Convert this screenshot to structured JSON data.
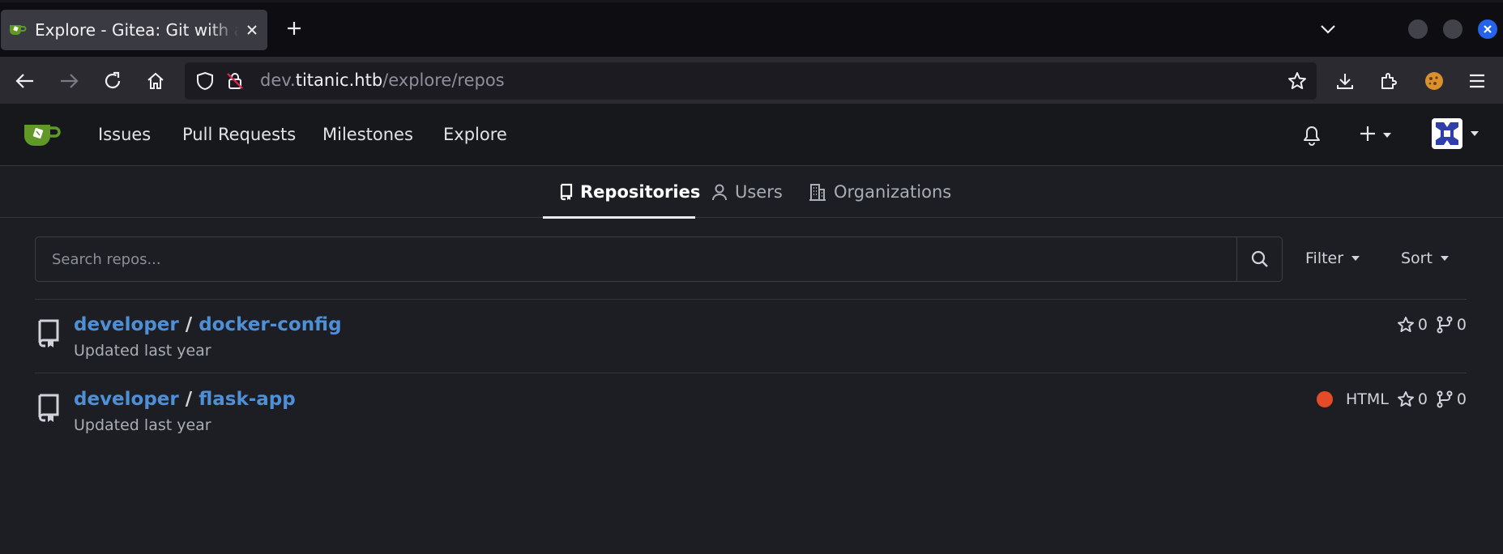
{
  "browser": {
    "tab_title": "Explore - Gitea: Git with a cup of tea",
    "url_host": "dev.titanic.htb",
    "url_prefix": "dev.",
    "url_domain": "titanic.htb",
    "url_path": "/explore/repos"
  },
  "nav": {
    "items": [
      "Issues",
      "Pull Requests",
      "Milestones",
      "Explore"
    ]
  },
  "explore_tabs": {
    "repositories": "Repositories",
    "users": "Users",
    "organizations": "Organizations"
  },
  "search": {
    "placeholder": "Search repos...",
    "filter_label": "Filter",
    "sort_label": "Sort"
  },
  "repos": [
    {
      "owner": "developer",
      "separator": "/",
      "name": "docker-config",
      "updated": "Updated last year",
      "language": "",
      "stars": "0",
      "forks": "0"
    },
    {
      "owner": "developer",
      "separator": "/",
      "name": "flask-app",
      "updated": "Updated last year",
      "language": "HTML",
      "language_color": "#e34c26",
      "stars": "0",
      "forks": "0"
    }
  ],
  "colors": {
    "link": "#4f8fd6",
    "accent_logo": "#609926"
  },
  "icons": {
    "tab_favicon": "gitea-icon",
    "tab_close": "close-icon",
    "new_tab": "plus-icon",
    "tab_list": "chevron-down-icon",
    "back": "arrow-left-icon",
    "forward": "arrow-right-icon",
    "reload": "reload-icon",
    "home": "home-icon",
    "shield": "shield-icon",
    "insecure": "lock-insecure-icon",
    "bookmark": "star-icon",
    "downloads": "download-icon",
    "extensions": "puzzle-icon",
    "menu": "hamburger-icon",
    "bell": "bell-icon",
    "create": "plus-icon",
    "search": "search-icon",
    "repo": "repo-icon",
    "star": "star-icon",
    "fork": "fork-icon"
  }
}
